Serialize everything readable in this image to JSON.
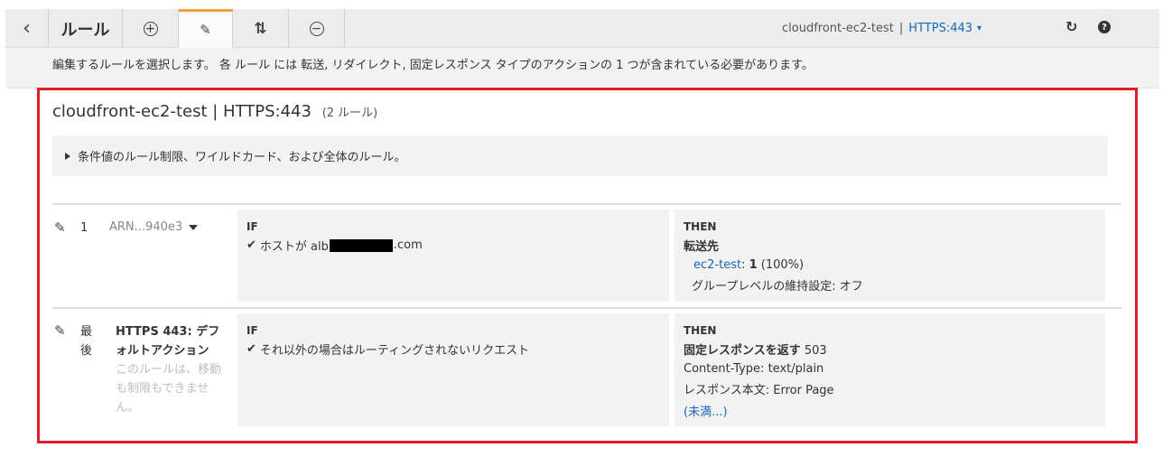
{
  "toolbar": {
    "back_icon": "‹",
    "title": "ルール",
    "add_icon": "+",
    "edit_icon": "✎",
    "reorder_icon": "⇅",
    "delete_icon": "−",
    "listener_name": "cloudfront-ec2-test",
    "separator": "|",
    "protocol_port": "HTTPS:443",
    "chevron": "⌄",
    "refresh_icon": "↻",
    "help_icon": "?",
    "accent_color": "#f2a23a"
  },
  "instruction": "編集するルールを選択します。 各 ルール には 転送, リダイレクト, 固定レスポンス タイプのアクションの 1 つが含まれている必要があります。",
  "listener": {
    "title": "cloudfront-ec2-test | HTTPS:443",
    "rule_count": "(2 ルール)",
    "limits_text": "条件値のルール制限、ワイルドカード、および全体のルール。"
  },
  "rules": [
    {
      "number": "1",
      "arn": "ARN...940e3",
      "if_label": "IF",
      "condition_prefix": "ホストが alb",
      "condition_suffix": ".com",
      "then_label": "THEN",
      "action_title": "転送先",
      "target_group": "ec2-test",
      "target_weight": "1",
      "target_percent": "(100%)",
      "stickiness": "グループレベルの維持設定: オフ"
    },
    {
      "number": "最後",
      "name": "HTTPS 443: デフォルトアクション",
      "description": "このルールは、移動も制限もできません。",
      "if_label": "IF",
      "condition": "それ以外の場合はルーティングされないリクエスト",
      "then_label": "THEN",
      "action_title": "固定レスポンスを返す",
      "status_code": "503",
      "content_type": "Content-Type: text/plain",
      "body": "レスポンス本文: Error Page",
      "more_link": "(未満...)"
    }
  ],
  "colors": {
    "highlight_frame": "#dc1f2a",
    "link": "#1a66b8"
  }
}
